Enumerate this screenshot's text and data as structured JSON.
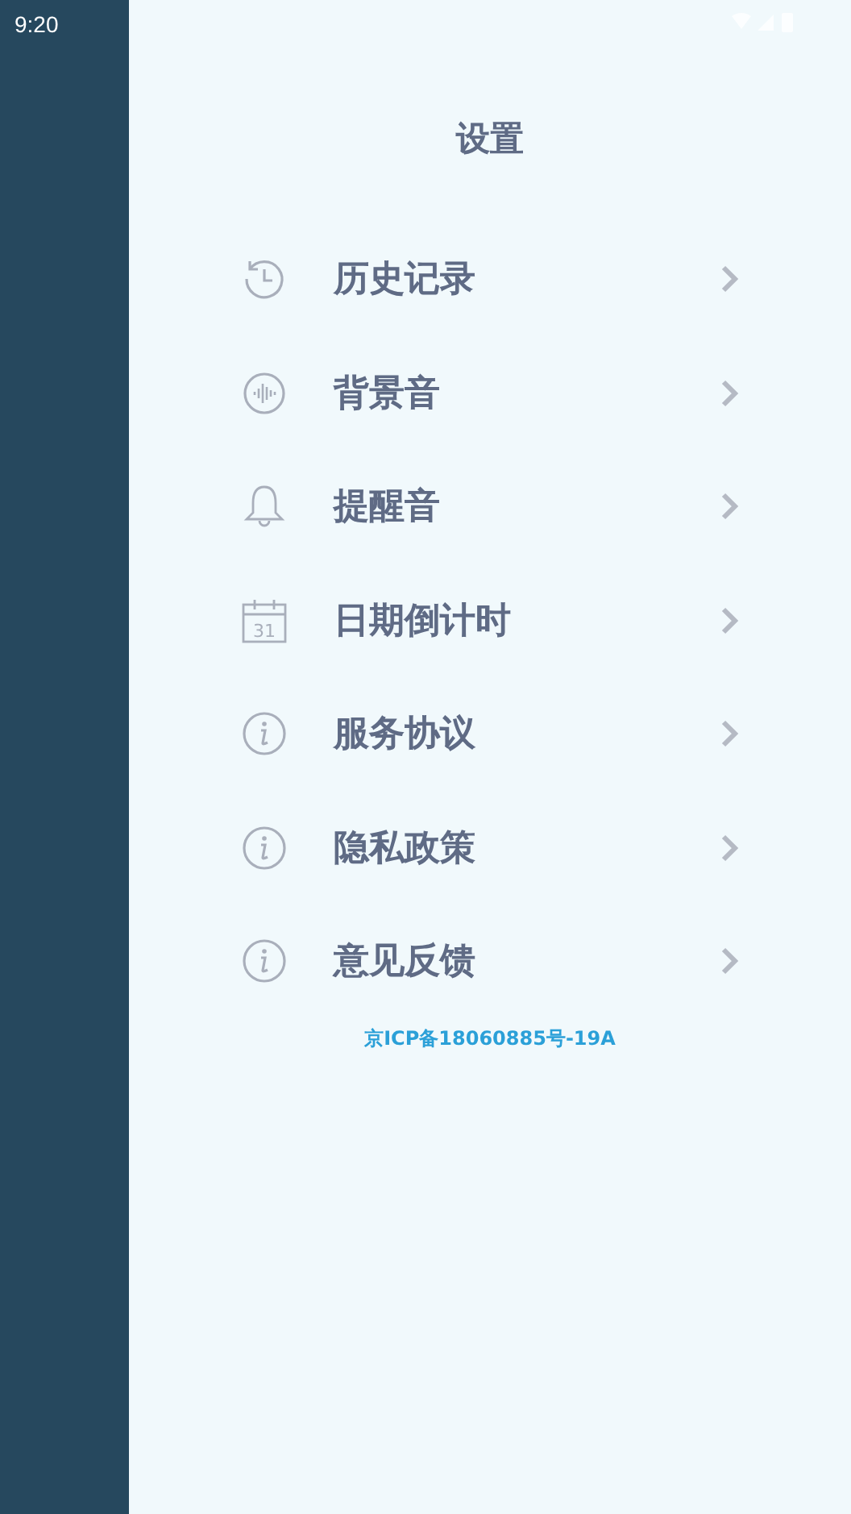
{
  "status_bar": {
    "time": "9:20"
  },
  "title": "设置",
  "menu": [
    {
      "kind": "history",
      "label": "历史记录"
    },
    {
      "kind": "sound",
      "label": "背景音"
    },
    {
      "kind": "bell",
      "label": "提醒音"
    },
    {
      "kind": "calendar",
      "label": "日期倒计时",
      "icon_text": "31"
    },
    {
      "kind": "info",
      "label": "服务协议"
    },
    {
      "kind": "info",
      "label": "隐私政策"
    },
    {
      "kind": "info",
      "label": "意见反馈"
    }
  ],
  "footer": "京ICP备18060885号-19A"
}
